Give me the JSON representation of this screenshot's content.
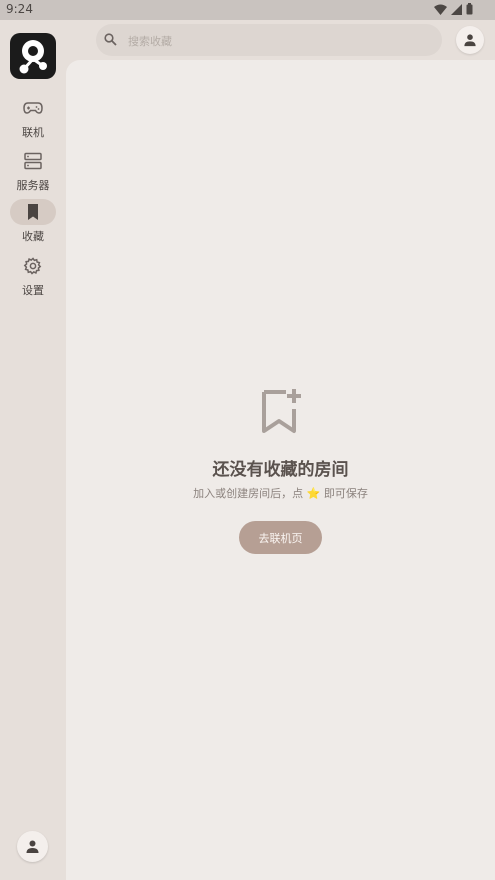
{
  "status_bar": {
    "time": "9:24",
    "icons": [
      "wifi-icon",
      "cellular-icon",
      "battery-icon"
    ]
  },
  "rail": {
    "items": [
      {
        "label": "联机",
        "icon": "gamepad-icon",
        "active": false
      },
      {
        "label": "服务器",
        "icon": "server-icon",
        "active": false
      },
      {
        "label": "收藏",
        "icon": "bookmark-icon",
        "active": true
      },
      {
        "label": "设置",
        "icon": "gear-icon",
        "active": false
      }
    ]
  },
  "search": {
    "placeholder": "搜索收藏",
    "value": ""
  },
  "empty_state": {
    "icon": "bookmark-add-icon",
    "title": "还没有收藏的房间",
    "desc_before": "加入或创建房间后，点",
    "star": "⭐",
    "desc_after": "即可保存",
    "button_label": "去联机页"
  },
  "colors": {
    "rail_bg": "#e6dfda",
    "content_bg": "#efebe8",
    "active_pill": "#d6cbc4",
    "button_bg": "#b69f94",
    "star": "#f1b93a"
  }
}
